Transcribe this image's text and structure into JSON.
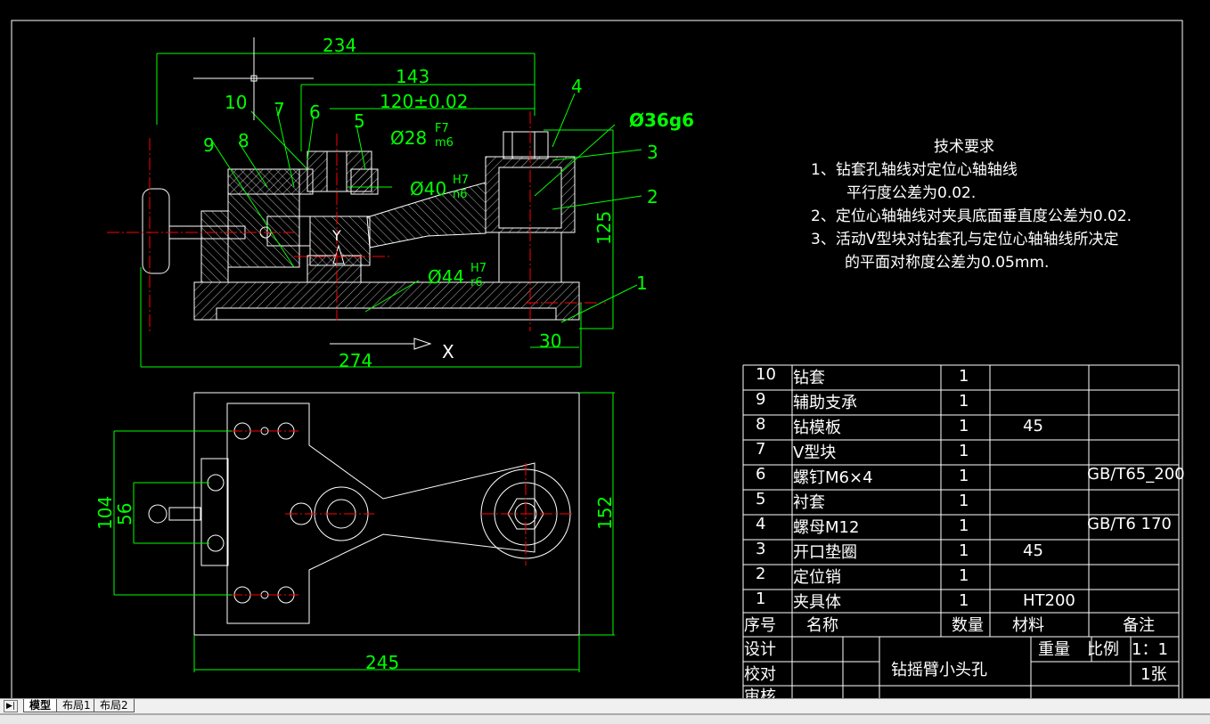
{
  "drawing": {
    "dimensions": {
      "d234": "234",
      "d143": "143",
      "d120": "120±0.02",
      "d274": "274",
      "d30": "30",
      "d125": "125",
      "d104": "104",
      "d56": "56",
      "d152": "152",
      "d245": "245",
      "fit28": "Ø28",
      "fit28_top": "F7",
      "fit28_bot": "m6",
      "fit40": "Ø40",
      "fit40_top": "H7",
      "fit40_bot": "n6",
      "fit44": "Ø44",
      "fit44_top": "H7",
      "fit44_bot": "r6",
      "fit36": "Ø36g6"
    },
    "part_labels": [
      "10",
      "7",
      "6",
      "5",
      "4",
      "9",
      "8",
      "3",
      "2",
      "1"
    ],
    "axis": {
      "x": "X",
      "y": "Y"
    },
    "colors": {
      "geometry": "#ffffff",
      "dimension": "#00ff00",
      "centerline": "#ff0000",
      "background": "#000000"
    }
  },
  "tech_requirements": {
    "title": "技术要求",
    "lines": [
      "1、钻套孔轴线对定位心轴轴线",
      "平行度公差为0.02.",
      "2、定位心轴轴线对夹具底面垂直度公差为0.02.",
      "3、活动V型块对钻套孔与定位心轴轴线所决定",
      "的平面对称度公差为0.05mm."
    ]
  },
  "parts_list": {
    "rows": [
      {
        "no": "10",
        "name": "钻套",
        "qty": "1",
        "material": "",
        "note": ""
      },
      {
        "no": "9",
        "name": "辅助支承",
        "qty": "1",
        "material": "",
        "note": ""
      },
      {
        "no": "8",
        "name": "钻模板",
        "qty": "1",
        "material": "45",
        "note": ""
      },
      {
        "no": "7",
        "name": "V型块",
        "qty": "1",
        "material": "",
        "note": ""
      },
      {
        "no": "6",
        "name": "螺钉M6×4",
        "qty": "1",
        "material": "",
        "note": "GB/T65_200"
      },
      {
        "no": "5",
        "name": "衬套",
        "qty": "1",
        "material": "",
        "note": ""
      },
      {
        "no": "4",
        "name": "螺母M12",
        "qty": "1",
        "material": "",
        "note": "GB/T6 170"
      },
      {
        "no": "3",
        "name": "开口垫圈",
        "qty": "1",
        "material": "45",
        "note": ""
      },
      {
        "no": "2",
        "name": "定位销",
        "qty": "1",
        "material": "",
        "note": ""
      },
      {
        "no": "1",
        "name": "夹具体",
        "qty": "1",
        "material": "HT200",
        "note": ""
      }
    ],
    "headers": {
      "no": "序号",
      "name": "名称",
      "qty": "数量",
      "material": "材料",
      "note": "备注"
    }
  },
  "title_block": {
    "design": "设计",
    "check": "校对",
    "review": "审核",
    "drawing_title": "钻摇臂小头孔",
    "weight": "重量",
    "scale_label": "比例",
    "scale": "1：1",
    "sheets": "1张"
  },
  "tabs": {
    "model": "模型",
    "layout1": "布局1",
    "layout2": "布局2",
    "active": "模型"
  }
}
